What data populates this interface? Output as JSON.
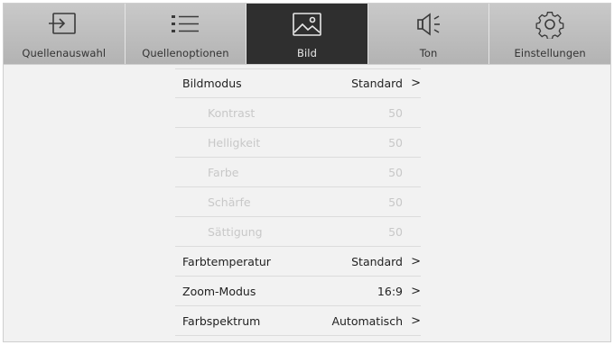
{
  "tabs": [
    {
      "label": "Quellenauswahl",
      "icon": "input-source-icon",
      "active": false
    },
    {
      "label": "Quellenoptionen",
      "icon": "list-icon",
      "active": false
    },
    {
      "label": "Bild",
      "icon": "picture-icon",
      "active": true
    },
    {
      "label": "Ton",
      "icon": "speaker-icon",
      "active": false
    },
    {
      "label": "Einstellungen",
      "icon": "gear-icon",
      "active": false
    }
  ],
  "menu": [
    {
      "label": "Bildmodus",
      "value": "Standard",
      "chevron": ">",
      "disabled": false
    },
    {
      "label": "Kontrast",
      "value": "50",
      "disabled": true
    },
    {
      "label": "Helligkeit",
      "value": "50",
      "disabled": true
    },
    {
      "label": "Farbe",
      "value": "50",
      "disabled": true
    },
    {
      "label": "Schärfe",
      "value": "50",
      "disabled": true
    },
    {
      "label": "Sättigung",
      "value": "50",
      "disabled": true
    },
    {
      "label": "Farbtemperatur",
      "value": "Standard",
      "chevron": ">",
      "disabled": false
    },
    {
      "label": "Zoom-Modus",
      "value": "16:9",
      "chevron": ">",
      "disabled": false
    },
    {
      "label": "Farbspektrum",
      "value": "Automatisch",
      "chevron": ">",
      "disabled": false
    }
  ],
  "colors": {
    "active_tab": "#2f2f2f",
    "inactive_tab": "#bdbdbd",
    "disabled_text": "#c8c8c8"
  }
}
